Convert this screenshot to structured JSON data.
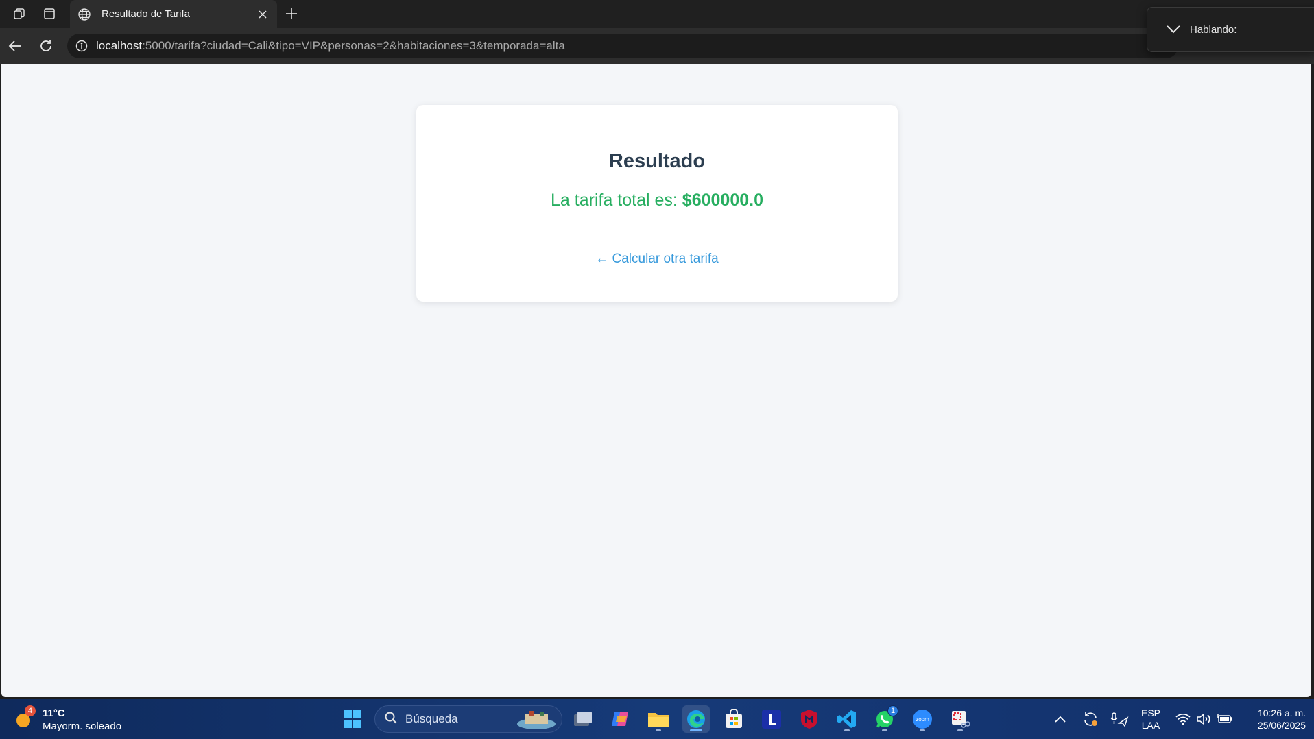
{
  "browser": {
    "tab_title": "Resultado de Tarifa",
    "url_host": "localhost",
    "url_rest": ":5000/tarifa?ciudad=Cali&tipo=VIP&personas=2&habitaciones=3&temporada=alta"
  },
  "toast": {
    "label": "Hablando:"
  },
  "page": {
    "heading": "Resultado",
    "result_prefix": "La tarifa total es: ",
    "result_amount": "$600000.0",
    "back_link": "← Calcular otra tarifa",
    "colors": {
      "heading": "#2c3e50",
      "result": "#27ae60",
      "link": "#3498db",
      "background": "#f4f6f9"
    }
  },
  "taskbar": {
    "weather": {
      "badge": "4",
      "temperature": "11°C",
      "condition": "Mayorm. soleado"
    },
    "search_placeholder": "Búsqueda",
    "whatsapp_badge": "1",
    "language": {
      "line1": "ESP",
      "line2": "LAA"
    },
    "clock": {
      "time": "10:26 a. m.",
      "date": "25/06/2025"
    },
    "zoom_label": "zoom"
  }
}
